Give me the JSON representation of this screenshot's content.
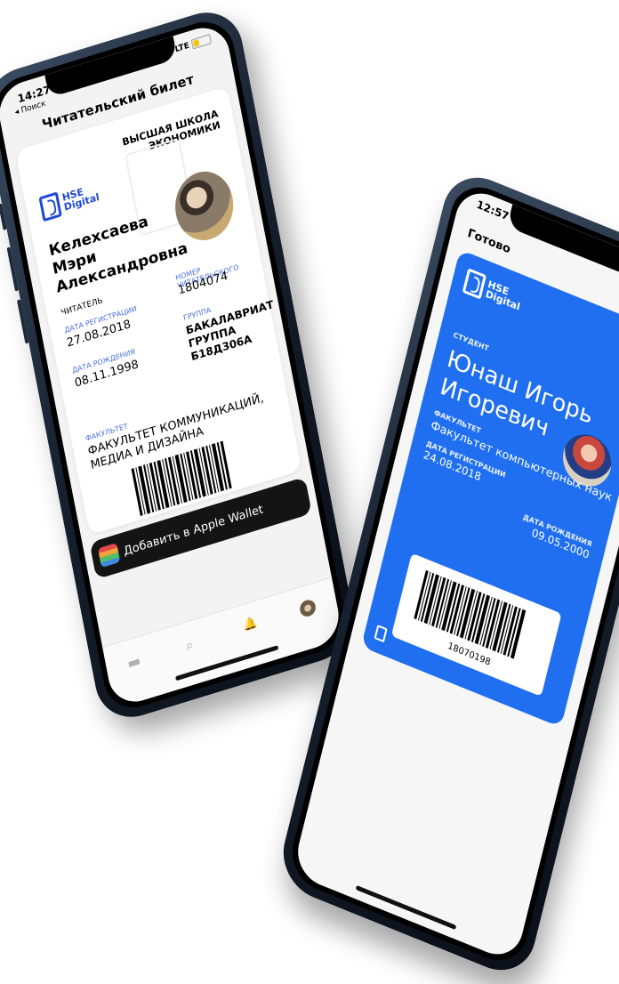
{
  "left_phone": {
    "status": {
      "time": "14:27",
      "back_label": "◂ Поиск",
      "network": "LTE"
    },
    "page_title": "Читательский билет",
    "card": {
      "logo_line1": "HSE",
      "logo_line2": "Digital",
      "university": "ВЫСШАЯ ШКОЛА ЭКОНОМИКИ",
      "name": "Келехсаева Мэри Александровна",
      "role": "ЧИТАТЕЛЬ",
      "reg_date_label": "ДАТА РЕГИСТРАЦИИ",
      "reg_date": "27.08.2018",
      "card_number_label": "НОМЕР ЧИТАТЕЛЬСКОГО",
      "card_number": "1804074",
      "birth_date_label": "ДАТА РОЖДЕНИЯ",
      "birth_date": "08.11.1998",
      "group_label": "ГРУППА",
      "group": "БАКАЛАВРИАТ ГРУППА Б18Д306А",
      "faculty_label": "ФАКУЛЬТЕТ",
      "faculty": "ФАКУЛЬТЕТ КОММУНИКАЦИЙ, МЕДИА И ДИЗАЙНА"
    },
    "wallet_button": "Добавить в Apple Wallet",
    "tabbar": {
      "tab1": "▬",
      "tab2": "⌕",
      "tab3": "🔔"
    }
  },
  "right_phone": {
    "status": {
      "time": "12:57"
    },
    "done_label": "Готово",
    "pass": {
      "logo_line1": "HSE",
      "logo_line2": "Digital",
      "more": "•••",
      "role_label": "СТУДЕНТ",
      "name": "Юнаш Игорь Игоревич",
      "faculty_label": "ФАКУЛЬТЕТ",
      "faculty": "Факультет компьютерных наук",
      "reg_date_label": "ДАТА РЕГИСТРАЦИИ",
      "reg_date": "24.08.2018",
      "birth_date_label": "ДАТА РОЖДЕНИЯ",
      "birth_date": "09.05.2000",
      "barcode_number": "18070198"
    }
  },
  "colors": {
    "accent": "#1e49d6",
    "pass_blue": "#1f6ff0",
    "wallet_button": "#141414"
  }
}
